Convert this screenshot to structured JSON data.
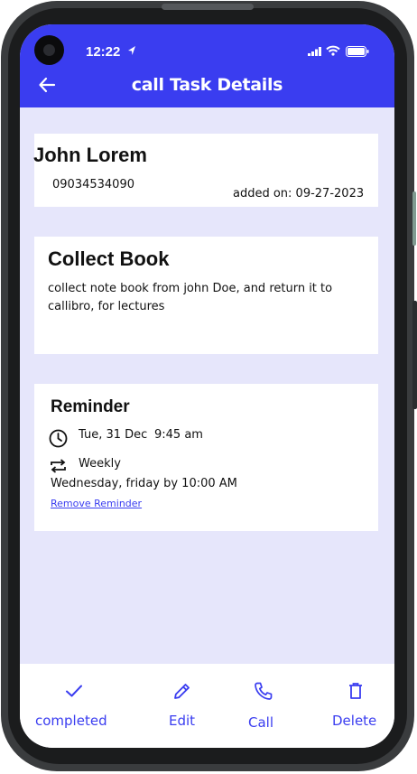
{
  "status_bar": {
    "time": "12:22"
  },
  "header": {
    "title": "call Task Details"
  },
  "contact": {
    "name": "John Lorem",
    "phone": "09034534090",
    "added_on": "added on: 09-27-2023"
  },
  "task": {
    "title": "Collect Book",
    "description": "collect note book from john Doe, and return it to callibro, for lectures"
  },
  "reminder": {
    "title": "Reminder",
    "date": "Tue, 31 Dec",
    "time": "9:45 am",
    "frequency": "Weekly",
    "schedule": "Wednesday, friday by 10:00 AM",
    "remove_label": "Remove Reminder"
  },
  "bottom_nav": {
    "completed": "completed",
    "edit": "Edit",
    "call": "Call",
    "delete": "Delete"
  },
  "icons": {
    "back": "arrow-left-icon",
    "clock": "clock-icon",
    "repeat": "repeat-icon",
    "check": "check-icon",
    "edit": "pencil-icon",
    "call": "phone-icon",
    "delete": "trash-icon"
  },
  "colors": {
    "accent": "#3a3df0",
    "background": "#e6e6fb",
    "card": "#ffffff"
  }
}
